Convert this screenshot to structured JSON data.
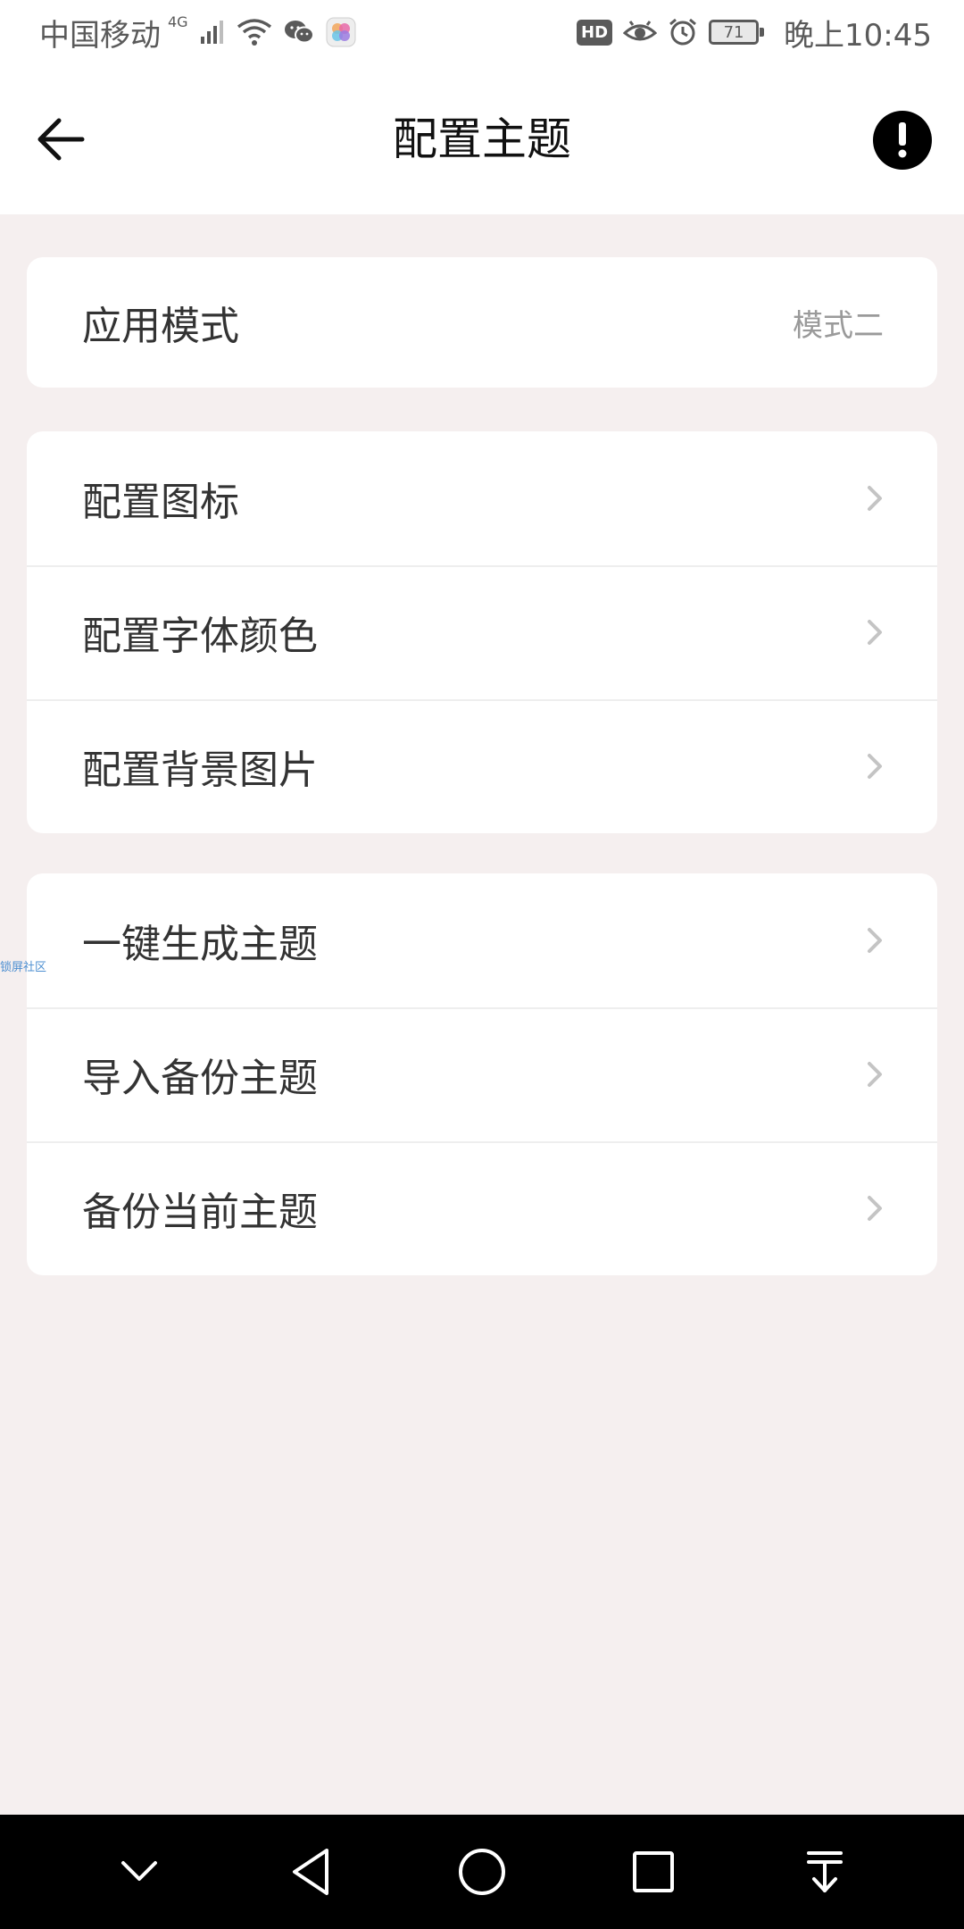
{
  "status_bar": {
    "carrier": "中国移动",
    "network": "4G",
    "hd": "HD",
    "battery": "71",
    "time": "晚上10:45"
  },
  "header": {
    "title": "配置主题"
  },
  "mode_card": {
    "label": "应用模式",
    "value": "模式二"
  },
  "config_card": {
    "items": [
      {
        "label": "配置图标"
      },
      {
        "label": "配置字体颜色"
      },
      {
        "label": "配置背景图片"
      }
    ]
  },
  "theme_card": {
    "items": [
      {
        "label": "一键生成主题"
      },
      {
        "label": "导入备份主题"
      },
      {
        "label": "备份当前主题"
      }
    ]
  },
  "watermark": "锁屏社区",
  "colors": {
    "background": "#f5efef",
    "card": "#ffffff",
    "text": "#333333",
    "secondary_text": "#9a9a9a",
    "nav_bar": "#000000"
  }
}
